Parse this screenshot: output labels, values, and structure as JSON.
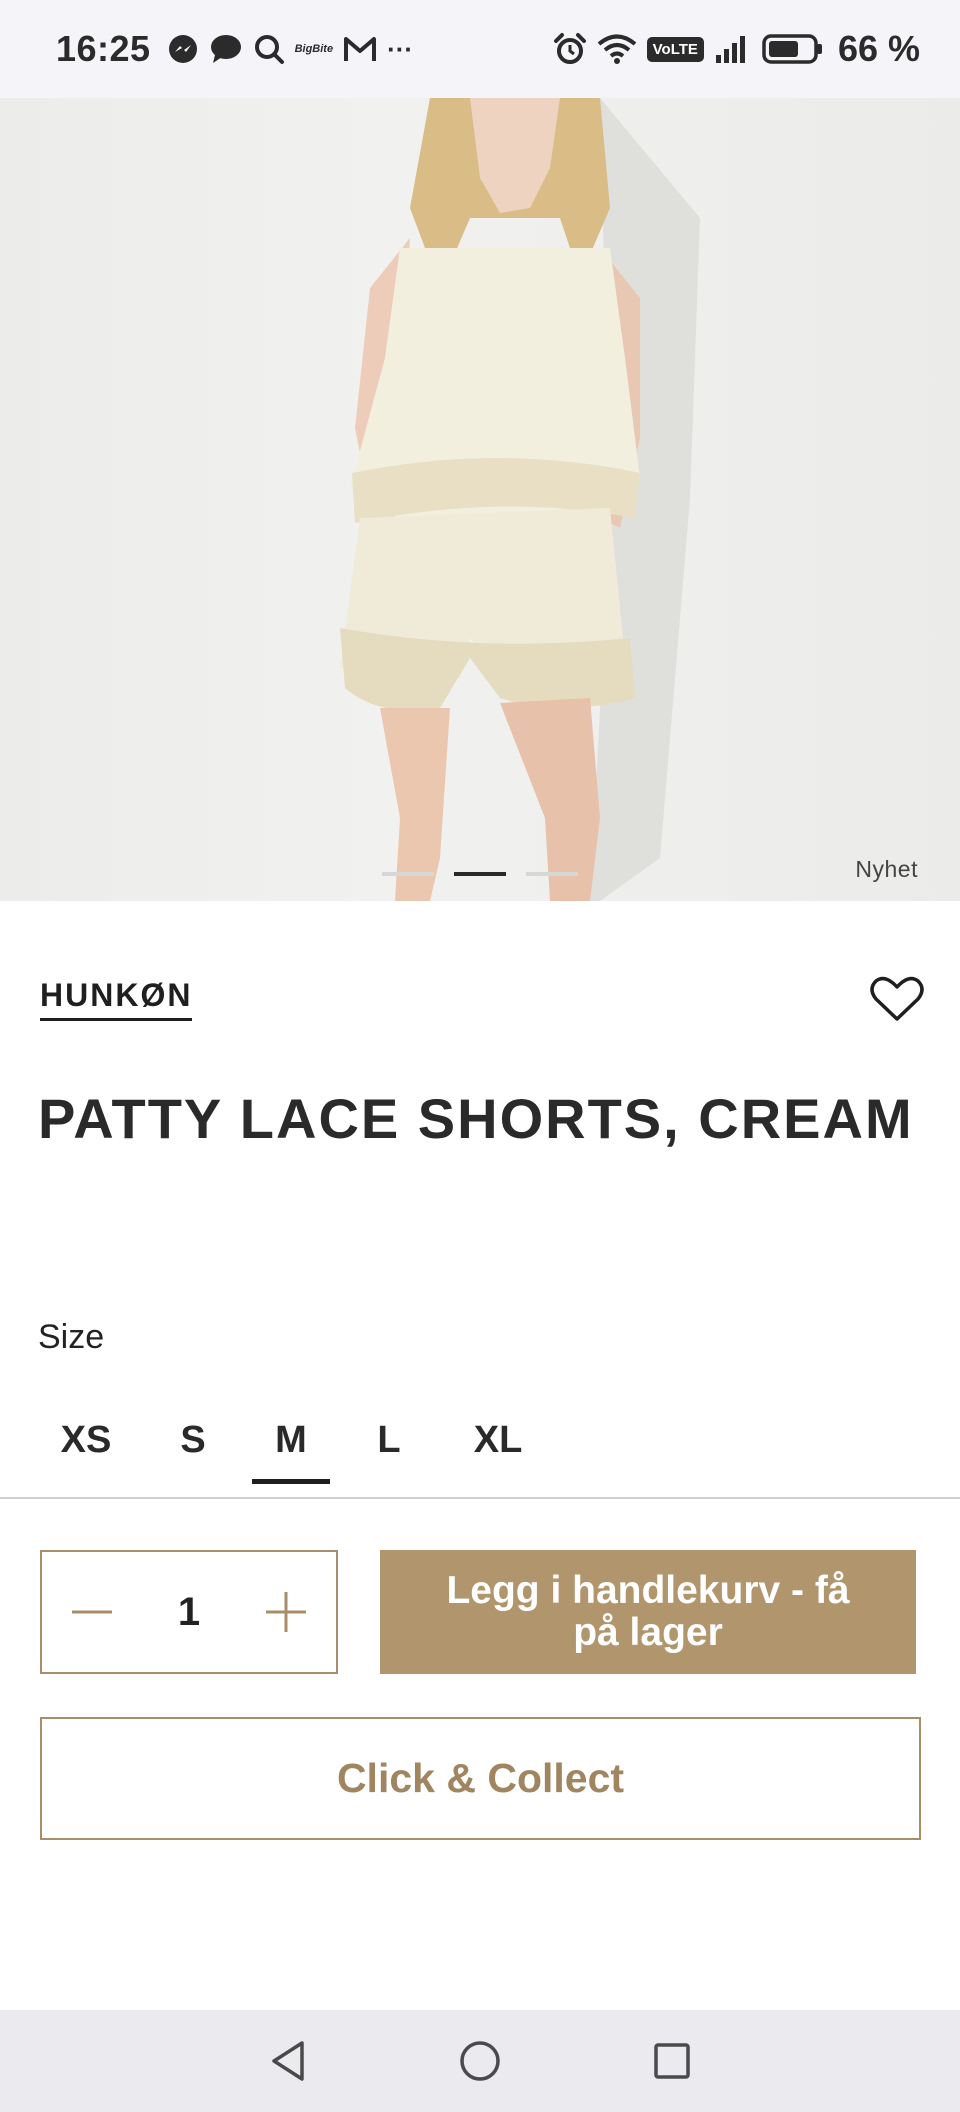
{
  "status_bar": {
    "time": "16:25",
    "notification_icons": [
      "messenger-icon",
      "chat-bubble-icon",
      "search-icon",
      "bigbite-icon",
      "gmail-icon",
      "more-dots-icon"
    ],
    "bigbite_text": "BigBite",
    "more": "···",
    "right_icons": [
      "alarm-icon",
      "wifi-icon",
      "volte-icon",
      "signal-icon",
      "battery-icon"
    ],
    "volte_label": "VoLTE",
    "battery_percent": "66 %",
    "battery_level": 0.66
  },
  "product_image": {
    "badge": "Nyhet",
    "carousel": {
      "count": 3,
      "active_index": 1
    }
  },
  "product": {
    "brand": "HUNKØN",
    "title": "PATTY LACE SHORTS, CREAM"
  },
  "size": {
    "label": "Size",
    "options": [
      "XS",
      "S",
      "M",
      "L",
      "XL"
    ],
    "selected": "M"
  },
  "purchase": {
    "quantity": "1",
    "add_to_cart_label": "Legg i handlekurv - få på lager",
    "click_collect_label": "Click & Collect"
  },
  "colors": {
    "accent": "#b1956d",
    "accent_border": "#a98d6a",
    "text_dark": "#2a2a2a"
  },
  "nav_bar": {
    "buttons": [
      "back-triangle-icon",
      "home-circle-icon",
      "recents-square-icon"
    ]
  }
}
